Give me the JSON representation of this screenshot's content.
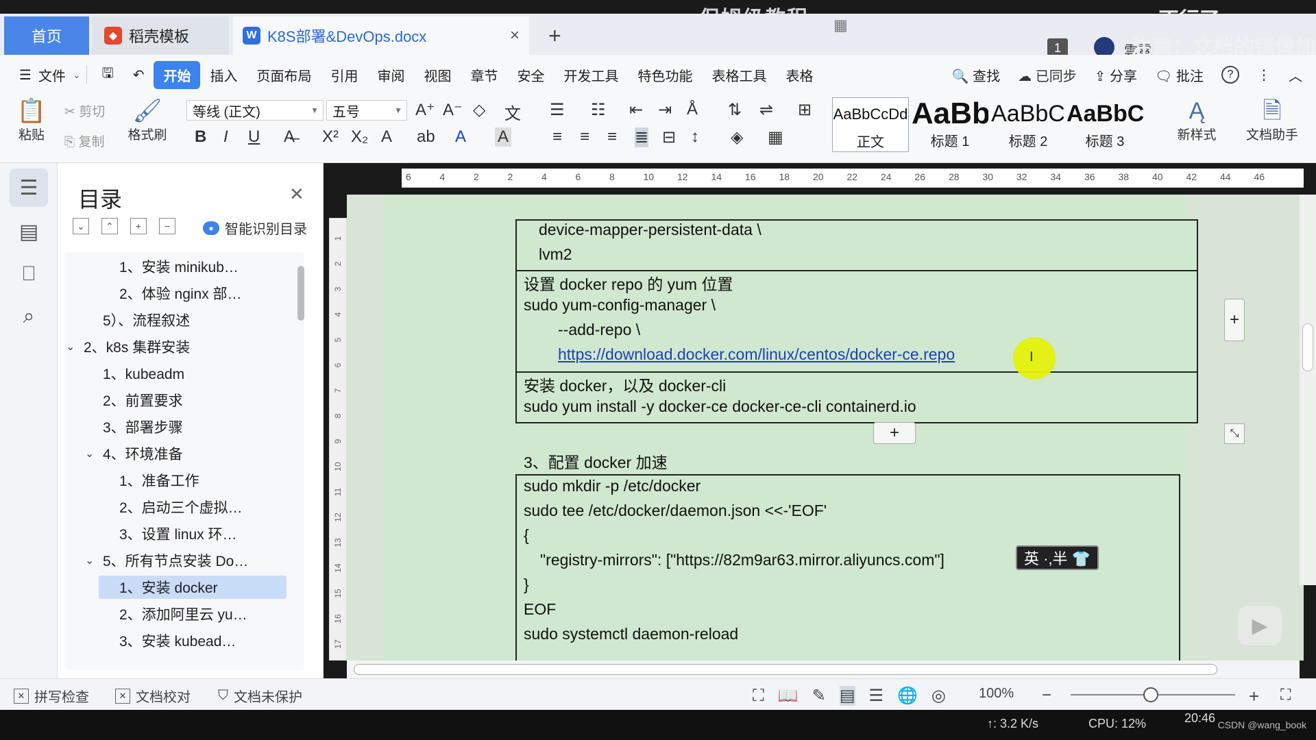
{
  "overlay": {
    "title": "保姆级教程",
    "top_right_1": "不行了",
    "top_right_2": "注意：文档的镜像加"
  },
  "tabs": {
    "home": "首页",
    "template": "稻壳模板",
    "document": "K8S部署&DevOps.docx",
    "close": "×",
    "add": "+"
  },
  "window": {
    "badge": "1",
    "user": "雲霄",
    "layout_icon": "▦"
  },
  "menu": {
    "file": "文件",
    "items": [
      "开始",
      "插入",
      "页面布局",
      "引用",
      "审阅",
      "视图",
      "章节",
      "安全",
      "开发工具",
      "特色功能",
      "表格工具",
      "表格"
    ],
    "find": "查找",
    "sync": "已同步",
    "share": "分享",
    "comment": "批注",
    "help": "?"
  },
  "ribbon": {
    "paste": "粘贴",
    "cut": "剪切",
    "copy": "复制",
    "format_painter": "格式刷",
    "font_name": "等线 (正文)",
    "font_size": "五号",
    "bold": "B",
    "italic": "I",
    "underline": "U",
    "styles": [
      {
        "sample": "AaBbCcDd",
        "label": "正文"
      },
      {
        "sample": "AaBb",
        "label": "标题 1"
      },
      {
        "sample": "AaBbC",
        "label": "标题 2"
      },
      {
        "sample": "AaBbC",
        "label": "标题 3"
      }
    ],
    "new_style": "新样式",
    "doc_assistant": "文档助手"
  },
  "toc": {
    "title": "目录",
    "smart": "智能识别目录",
    "items": [
      {
        "text": "1、安装 minikub…",
        "level": 2,
        "arrow": ""
      },
      {
        "text": "2、体验 nginx 部…",
        "level": 2,
        "arrow": ""
      },
      {
        "text": "5）、流程叙述",
        "level": 1,
        "arrow": ""
      },
      {
        "text": "2、k8s 集群安装",
        "level": 0,
        "arrow": "v"
      },
      {
        "text": "1、kubeadm",
        "level": 1,
        "arrow": ""
      },
      {
        "text": "2、前置要求",
        "level": 1,
        "arrow": ""
      },
      {
        "text": "3、部署步骤",
        "level": 1,
        "arrow": ""
      },
      {
        "text": "4、环境准备",
        "level": 1,
        "arrow": "v"
      },
      {
        "text": "1、准备工作",
        "level": 2,
        "arrow": ""
      },
      {
        "text": "2、启动三个虚拟…",
        "level": 2,
        "arrow": ""
      },
      {
        "text": "3、设置 linux 环…",
        "level": 2,
        "arrow": ""
      },
      {
        "text": "5、所有节点安装 Do…",
        "level": 1,
        "arrow": "v"
      },
      {
        "text": "1、安装 docker",
        "level": 2,
        "arrow": "",
        "active": true
      },
      {
        "text": "2、添加阿里云 yu…",
        "level": 2,
        "arrow": ""
      },
      {
        "text": "3、安装 kubead…",
        "level": 2,
        "arrow": ""
      }
    ]
  },
  "hruler": [
    "6",
    "4",
    "2",
    "2",
    "4",
    "6",
    "8",
    "10",
    "12",
    "14",
    "16",
    "18",
    "20",
    "22",
    "24",
    "26",
    "28",
    "30",
    "32",
    "34",
    "36",
    "38",
    "40",
    "42",
    "44",
    "46"
  ],
  "vruler": [
    "1",
    "2",
    "3",
    "4",
    "5",
    "6",
    "7",
    "8",
    "9",
    "10",
    "11",
    "12",
    "13",
    "14",
    "15",
    "16",
    "17"
  ],
  "doc": {
    "t1": [
      "device-mapper-persistent-data \\",
      "lvm2"
    ],
    "t2": [
      "设置 docker repo 的 yum 位置",
      "sudo yum-config-manager \\",
      "--add-repo \\"
    ],
    "t2_link": "https://download.docker.com/linux/centos/docker-ce.repo",
    "t3": [
      "安装 docker，以及 docker-cli",
      "sudo yum install -y docker-ce docker-ce-cli containerd.io"
    ],
    "heading": "3、配置 docker 加速",
    "t4": [
      "sudo mkdir -p /etc/docker",
      "sudo tee /etc/docker/daemon.json <<-'EOF'",
      "{",
      "\"registry-mirrors\": [\"https://82m9ar63.mirror.aliyuncs.com\"]",
      "}",
      "EOF",
      "sudo systemctl daemon-reload"
    ],
    "ime": "英 ·,半 👕",
    "add": "+"
  },
  "status": {
    "spell": "拼写检查",
    "proof": "文档校对",
    "protect": "文档未保护",
    "zoom": "100%"
  },
  "taskbar": {
    "net": "↑: 3.2 K/s",
    "cpu": "CPU: 12%",
    "time": "20:46",
    "watermark": "CSDN @wang_book"
  }
}
